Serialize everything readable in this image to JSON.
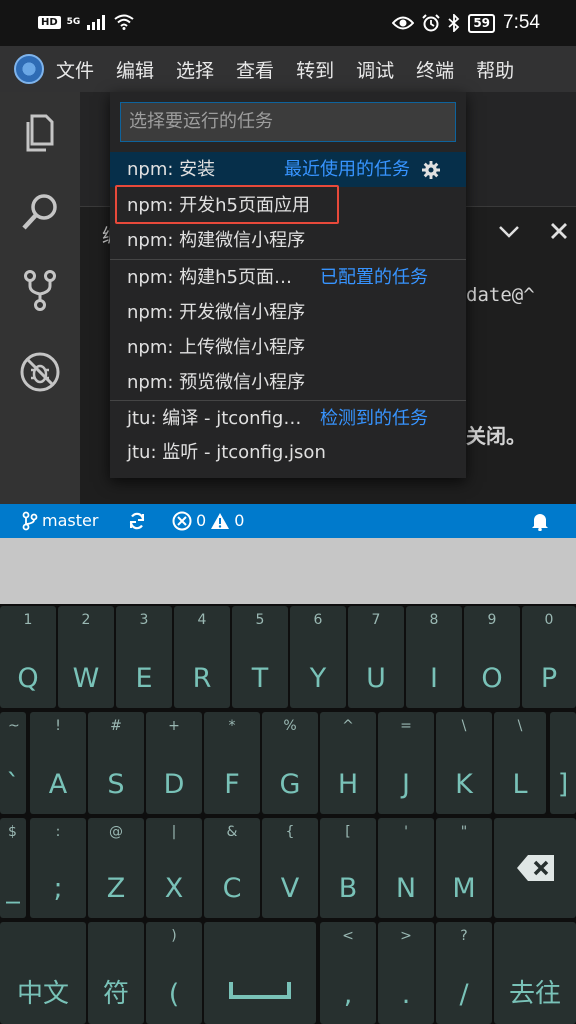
{
  "status_bar": {
    "hd": "HD",
    "signal": "5G",
    "battery": "59",
    "time": "7:54"
  },
  "menu": [
    "文件",
    "编辑",
    "选择",
    "查看",
    "转到",
    "调试",
    "终端",
    "帮助"
  ],
  "quick_pick": {
    "placeholder": "选择要运行的任务",
    "rows": [
      {
        "label": "npm: 安装",
        "category": "最近使用的任务"
      },
      {
        "label": "npm: 开发h5页面应用",
        "category": ""
      },
      {
        "label": "npm: 构建微信小程序",
        "category": ""
      },
      {
        "label": "npm: 构建h5页面…",
        "category": "已配置的任务"
      },
      {
        "label": "npm: 开发微信小程序",
        "category": ""
      },
      {
        "label": "npm: 上传微信小程序",
        "category": ""
      },
      {
        "label": "npm: 预览微信小程序",
        "category": ""
      },
      {
        "label": "jtu: 编译 - jtconfig…",
        "category": "检测到的任务"
      },
      {
        "label": "jtu: 监听 - jtconfig.json",
        "category": ""
      }
    ]
  },
  "background": {
    "panel_fragment": "编",
    "code_fragment": "date@^",
    "notice_fragment": "关闭。"
  },
  "vs_status": {
    "branch": "master",
    "errors": "0",
    "warnings": "0"
  },
  "keyboard": {
    "row1_top": [
      "1",
      "2",
      "3",
      "4",
      "5",
      "6",
      "7",
      "8",
      "9",
      "0"
    ],
    "row1": [
      "Q",
      "W",
      "E",
      "R",
      "T",
      "Y",
      "U",
      "I",
      "O",
      "P"
    ],
    "row2_top": [
      "~",
      "!",
      "#",
      "+",
      "*",
      "%",
      "^",
      "=",
      "\\",
      ""
    ],
    "row2": [
      "`",
      "A",
      "S",
      "D",
      "F",
      "G",
      "H",
      "J",
      "K",
      "L",
      "]"
    ],
    "row2_first_top": "",
    "row3_top": [
      "$",
      ":",
      "@",
      "|",
      "&",
      "{",
      "[",
      "'",
      "\""
    ],
    "row3": [
      "_",
      ";",
      "Z",
      "X",
      "C",
      "V",
      "B",
      "N",
      "M"
    ],
    "row4": {
      "lang": "中文",
      "sym": "符",
      "paren_top": ")",
      "paren": "(",
      "space": "␣",
      "comma_top": "<",
      "comma": ",",
      "dot_top": ">",
      "dot": ".",
      "slash_top": "?",
      "slash": "/",
      "go": "去往"
    }
  }
}
